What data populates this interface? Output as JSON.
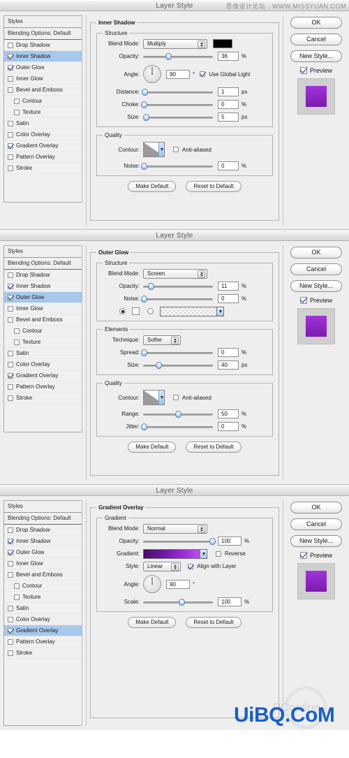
{
  "window": {
    "title": "Layer Style"
  },
  "watermarks": {
    "top": "思缘设计论坛 · WWW.MISSYUAN.COM",
    "bottom": "UiBQ.CoM",
    "faint": "PConline"
  },
  "sidebar": {
    "header": "Styles",
    "blending_options": "Blending Options: Default",
    "items": [
      {
        "label": "Drop Shadow",
        "checked": false,
        "indent": false
      },
      {
        "label": "Inner Shadow",
        "checked": true,
        "indent": false
      },
      {
        "label": "Outer Glow",
        "checked": true,
        "indent": false
      },
      {
        "label": "Inner Glow",
        "checked": false,
        "indent": false
      },
      {
        "label": "Bevel and Emboss",
        "checked": false,
        "indent": false
      },
      {
        "label": "Contour",
        "checked": false,
        "indent": true
      },
      {
        "label": "Texture",
        "checked": false,
        "indent": true
      },
      {
        "label": "Satin",
        "checked": false,
        "indent": false
      },
      {
        "label": "Color Overlay",
        "checked": false,
        "indent": false
      },
      {
        "label": "Gradient Overlay",
        "checked": true,
        "indent": false
      },
      {
        "label": "Pattern Overlay",
        "checked": false,
        "indent": false
      },
      {
        "label": "Stroke",
        "checked": false,
        "indent": false
      }
    ]
  },
  "buttons": {
    "ok": "OK",
    "cancel": "Cancel",
    "new_style": "New Style...",
    "preview": "Preview",
    "make_default": "Make Default",
    "reset_to_default": "Reset to Default"
  },
  "colors": {
    "selection_blue": "#a6c8ec",
    "shadow_color": "#000000",
    "gradient_start": "#4a0f63",
    "gradient_end": "#b24ef0",
    "preview_swatch_top": "#9a2fd4",
    "preview_swatch_bottom": "#7c1fae"
  },
  "panels": [
    {
      "id": "inner-shadow",
      "selected_effect": "Inner Shadow",
      "title": "Inner Shadow",
      "groups": [
        {
          "name": "Structure",
          "rows": [
            {
              "label": "Blend Mode:",
              "type": "popup",
              "value": "Multiply",
              "swatch": "#000000"
            },
            {
              "label": "Opacity:",
              "type": "slider",
              "value": "36",
              "unit": "%",
              "pos": 36
            },
            {
              "label": "Angle:",
              "type": "dial",
              "value": "90",
              "unit": "°",
              "checkbox_label": "Use Global Light",
              "checked": true
            },
            {
              "label": "Distance:",
              "type": "slider",
              "value": "1",
              "unit": "px",
              "pos": 2
            },
            {
              "label": "Choke:",
              "type": "slider",
              "value": "0",
              "unit": "%",
              "pos": 0
            },
            {
              "label": "Size:",
              "type": "slider",
              "value": "5",
              "unit": "px",
              "pos": 4
            }
          ]
        },
        {
          "name": "Quality",
          "rows": [
            {
              "label": "Contour:",
              "type": "contour",
              "checkbox_label": "Anti-aliased",
              "checked": false
            },
            {
              "label": "Noise:",
              "type": "slider",
              "value": "0",
              "unit": "%",
              "pos": 0
            }
          ]
        }
      ]
    },
    {
      "id": "outer-glow",
      "selected_effect": "Outer Glow",
      "title": "Outer Glow",
      "groups": [
        {
          "name": "Structure",
          "rows": [
            {
              "label": "Blend Mode:",
              "type": "popup",
              "value": "Screen"
            },
            {
              "label": "Opacity:",
              "type": "slider",
              "value": "11",
              "unit": "%",
              "pos": 11
            },
            {
              "label": "Noise:",
              "type": "slider",
              "value": "0",
              "unit": "%",
              "pos": 0
            },
            {
              "label": "",
              "type": "fill-choice",
              "mode": "color",
              "gradient": "transparent-white"
            }
          ]
        },
        {
          "name": "Elements",
          "rows": [
            {
              "label": "Technique:",
              "type": "popup",
              "value": "Softer"
            },
            {
              "label": "Spread:",
              "type": "slider",
              "value": "0",
              "unit": "%",
              "pos": 0
            },
            {
              "label": "Size:",
              "type": "slider",
              "value": "40",
              "unit": "px",
              "pos": 22
            }
          ]
        },
        {
          "name": "Quality",
          "rows": [
            {
              "label": "Contour:",
              "type": "contour",
              "checkbox_label": "Anti-aliased",
              "checked": false
            },
            {
              "label": "Range:",
              "type": "slider",
              "value": "50",
              "unit": "%",
              "pos": 50
            },
            {
              "label": "Jitter:",
              "type": "slider",
              "value": "0",
              "unit": "%",
              "pos": 0
            }
          ]
        }
      ]
    },
    {
      "id": "gradient-overlay",
      "selected_effect": "Gradient Overlay",
      "title": "Gradient Overlay",
      "groups": [
        {
          "name": "Gradient",
          "rows": [
            {
              "label": "Blend Mode:",
              "type": "popup",
              "value": "Normal"
            },
            {
              "label": "Opacity:",
              "type": "slider",
              "value": "100",
              "unit": "%",
              "pos": 100
            },
            {
              "label": "Gradient:",
              "type": "gradient",
              "checkbox_label": "Reverse",
              "checked": false
            },
            {
              "label": "Style:",
              "type": "popup",
              "value": "Linear",
              "checkbox_label": "Align with Layer",
              "checked": true
            },
            {
              "label": "Angle:",
              "type": "dial",
              "value": "90",
              "unit": "°"
            },
            {
              "label": "Scale:",
              "type": "slider",
              "value": "100",
              "unit": "%",
              "pos": 55
            }
          ]
        }
      ]
    }
  ]
}
